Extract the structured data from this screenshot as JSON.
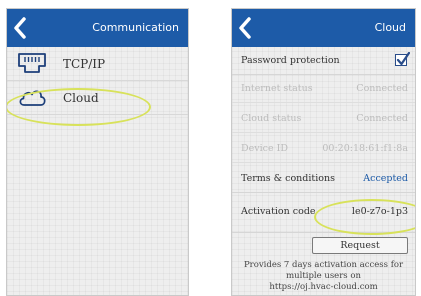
{
  "left": {
    "header": {
      "title": "Communication"
    },
    "items": [
      {
        "label": "TCP/IP",
        "icon": "ethernet-port-icon"
      },
      {
        "label": "Cloud",
        "icon": "cloud-icon"
      }
    ]
  },
  "right": {
    "header": {
      "title": "Cloud"
    },
    "password_protection": {
      "label": "Password protection",
      "checked": true
    },
    "internet_status": {
      "label": "Internet status",
      "value": "Connected"
    },
    "cloud_status": {
      "label": "Cloud status",
      "value": "Connected"
    },
    "device_id": {
      "label": "Device ID",
      "value": "00:20:18:61:f1:8a"
    },
    "terms": {
      "label": "Terms & conditions",
      "value": "Accepted"
    },
    "activation": {
      "label": "Activation code",
      "value": "le0-z7o-1p3"
    },
    "request_button": "Request",
    "info_lines": [
      "Provides 7 days activation access for",
      "multiple users on",
      "https://oj.hvac-cloud.com"
    ]
  },
  "colors": {
    "header_blue": "#1d5ba8",
    "highlight_ellipse": "#d8e25a",
    "disabled_text": "#bcbcbc"
  }
}
